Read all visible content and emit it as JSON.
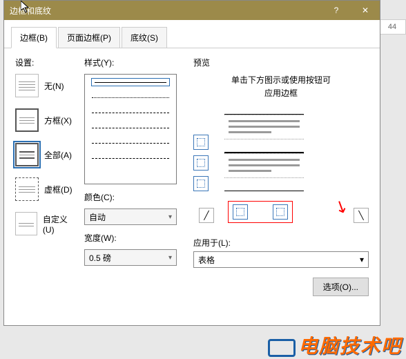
{
  "title": "边框和底纹",
  "tabs": {
    "border": "边框(B)",
    "page": "页面边框(P)",
    "shading": "底纹(S)"
  },
  "side_page": "44",
  "settings": {
    "label": "设置:",
    "none": "无(N)",
    "box": "方框(X)",
    "all": "全部(A)",
    "shadow": "虚框(D)",
    "custom": "自定义(U)"
  },
  "style": {
    "label": "样式(Y):",
    "color_label": "颜色(C):",
    "color_value": "自动",
    "width_label": "宽度(W):",
    "width_value": "0.5 磅"
  },
  "preview": {
    "label": "预览",
    "hint1": "单击下方图示或使用按钮可",
    "hint2": "应用边框",
    "apply_label": "应用于(L):",
    "apply_value": "表格",
    "options": "选项(O)..."
  },
  "watermark": "电脑技术吧"
}
